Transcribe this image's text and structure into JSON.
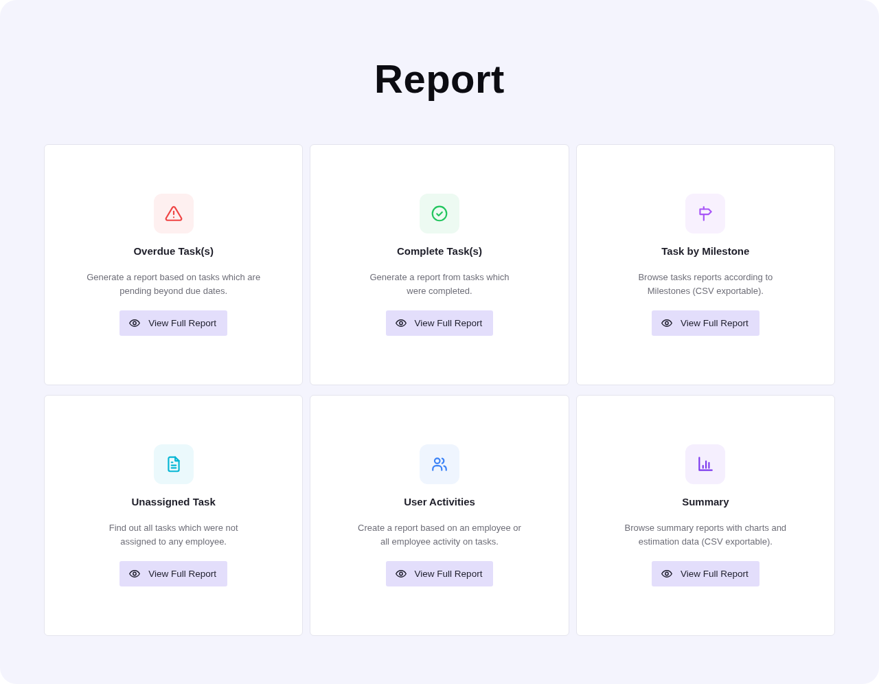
{
  "page": {
    "title": "Report"
  },
  "reports": [
    {
      "kind": "warning",
      "color": "#ef4444",
      "title": "Overdue Task(s)",
      "description_lines": [
        "Generate a report based on tasks which are",
        "pending beyond due dates."
      ],
      "button": "View Full Report"
    },
    {
      "kind": "check",
      "color": "#22c55e",
      "title": "Complete Task(s)",
      "description_lines": [
        "Generate a report from tasks which",
        "were completed."
      ],
      "button": "View Full Report"
    },
    {
      "kind": "signpost",
      "color": "#a855f7",
      "title": "Task by Milestone",
      "description_lines": [
        "Browse tasks reports according to",
        "Milestones (CSV exportable)."
      ],
      "button": "View Full Report"
    },
    {
      "kind": "document",
      "color": "#06b6d4",
      "title": "Unassigned Task",
      "description_lines": [
        "Find out all tasks which were not",
        "assigned to any employee."
      ],
      "button": "View Full Report"
    },
    {
      "kind": "users",
      "color": "#3b82f6",
      "title": "User Activities",
      "description_lines": [
        "Create a report based on an employee or",
        "all employee activity on tasks."
      ],
      "button": "View Full Report"
    },
    {
      "kind": "bar-chart",
      "color": "#7c3aed",
      "title": "Summary",
      "description_lines": [
        "Browse summary reports with charts and",
        "estimation data (CSV exportable)."
      ],
      "button": "View Full Report"
    }
  ]
}
